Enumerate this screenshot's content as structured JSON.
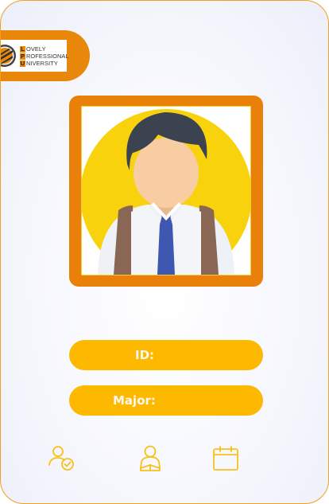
{
  "logo": {
    "line1": {
      "initial": "L",
      "rest": "OVELY"
    },
    "line2": {
      "initial": "P",
      "rest": "ROFESSIONAL"
    },
    "line3": {
      "initial": "U",
      "rest": "NIVERSITY"
    },
    "accent_color": "#e9870b"
  },
  "profile": {
    "photo_icon": "student-avatar-icon"
  },
  "fields": {
    "id": {
      "label": "ID:",
      "value": ""
    },
    "major": {
      "label": "Major:",
      "value": ""
    }
  },
  "nav": {
    "items": [
      {
        "icon": "user-check-icon"
      },
      {
        "icon": "student-reading-icon"
      },
      {
        "icon": "calendar-icon"
      }
    ]
  },
  "colors": {
    "frame": "#e9800a",
    "pill": "#fcb900",
    "icon": "#f7c11a",
    "border": "#f0a020"
  }
}
